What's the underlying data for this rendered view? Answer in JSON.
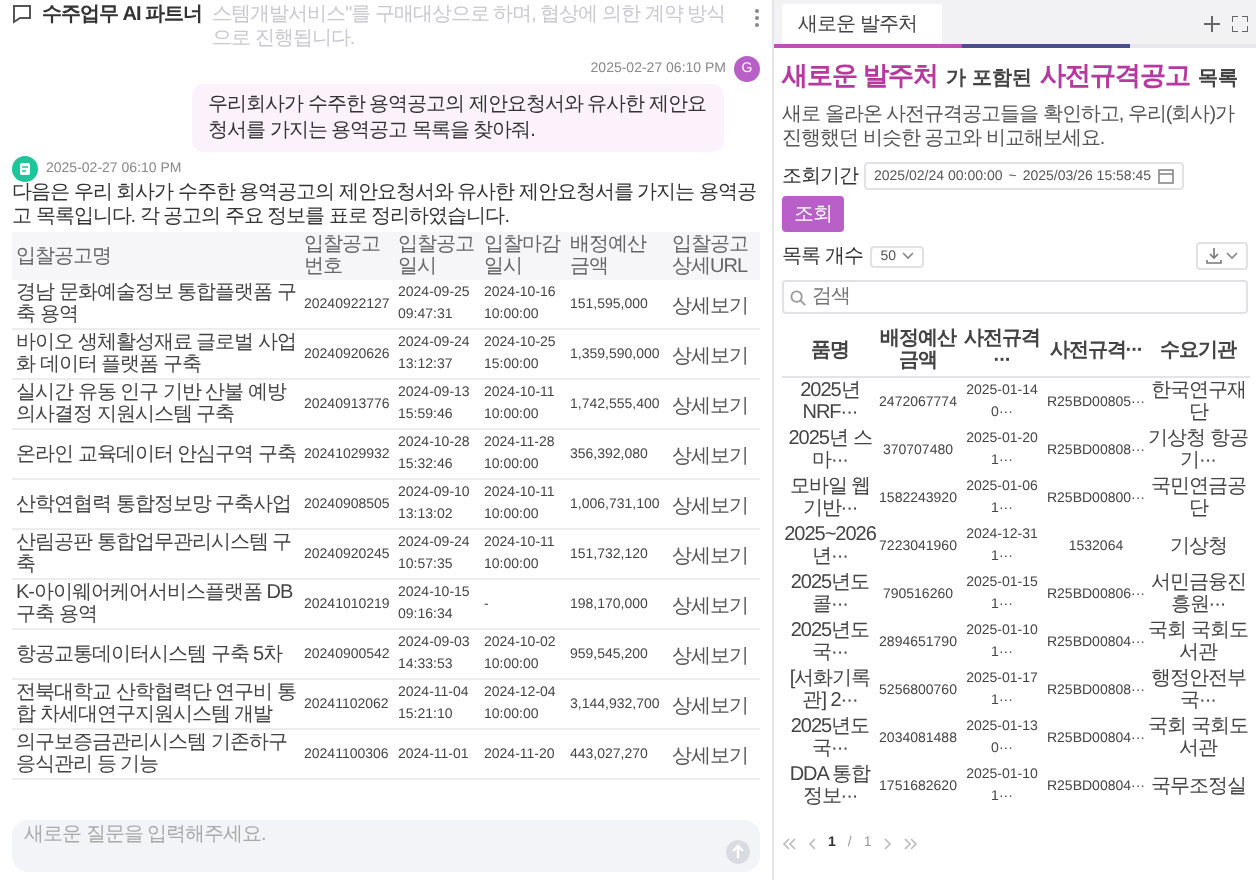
{
  "header": {
    "title": "수주업무 AI 파트너",
    "faded_text": "스템개발서비스\"를 구매대상으로 하며, 협상에 의한 계약 방식으로 진행됩니다."
  },
  "messages": [
    {
      "kind": "user",
      "time": "2025-02-27 06:10 PM",
      "avatar": "G",
      "text": "우리회사가 수주한 용역공고의 제안요청서와 유사한 제안요청서를 가지는 용역공고 목록을 찾아줘."
    },
    {
      "kind": "bot",
      "time": "2025-02-27 06:10 PM",
      "text": "다음은 우리 회사가 수주한 용역공고의 제안요청서와 유사한 제안요청서를 가지는 용역공고 목록입니다. 각 공고의 주요 정보를 표로 정리하였습니다.",
      "table": {
        "columns": [
          {
            "label": "입찰공고명",
            "kind": "text"
          },
          {
            "label": "입찰공고번호",
            "kind": "number"
          },
          {
            "label": "입찰공고일시",
            "kind": "datetime"
          },
          {
            "label": "입찰마감일시",
            "kind": "datetime"
          },
          {
            "label": "배정예산금액",
            "kind": "number"
          },
          {
            "label": "입찰공고상세URL",
            "kind": "link"
          }
        ],
        "rows": [
          [
            "경남 문화예술정보 통합플랫폼 구축 용역",
            "20240922127",
            [
              "2024-09-25",
              "09:47:31"
            ],
            [
              "2024-10-16",
              "10:00:00"
            ],
            "151,595,000",
            "상세보기"
          ],
          [
            "바이오 생체활성재료 글로벌 사업화 데이터 플랫폼 구축",
            "20240920626",
            [
              "2024-09-24",
              "13:12:37"
            ],
            [
              "2024-10-25",
              "15:00:00"
            ],
            "1,359,590,000",
            "상세보기"
          ],
          [
            "실시간 유동 인구 기반 산불 예방 의사결정 지원시스템 구축",
            "20240913776",
            [
              "2024-09-13",
              "15:59:46"
            ],
            [
              "2024-10-11",
              "10:00:00"
            ],
            "1,742,555,400",
            "상세보기"
          ],
          [
            "온라인 교육데이터 안심구역 구축",
            "20241029932",
            [
              "2024-10-28",
              "15:32:46"
            ],
            [
              "2024-11-28",
              "10:00:00"
            ],
            "356,392,080",
            "상세보기"
          ],
          [
            "산학연협력 통합정보망 구축사업",
            "20240908505",
            [
              "2024-09-10",
              "13:13:02"
            ],
            [
              "2024-10-11",
              "10:00:00"
            ],
            "1,006,731,100",
            "상세보기"
          ],
          [
            "산림공판 통합업무관리시스템 구축",
            "20240920245",
            [
              "2024-09-24",
              "10:57:35"
            ],
            [
              "2024-10-11",
              "10:00:00"
            ],
            "151,732,120",
            "상세보기"
          ],
          [
            "K-아이웨어케어서비스플랫폼 DB 구축 용역",
            "20241010219",
            [
              "2024-10-15",
              "09:16:34"
            ],
            [
              "-"
            ],
            "198,170,000",
            "상세보기"
          ],
          [
            "항공교통데이터시스템 구축 5차",
            "20240900542",
            [
              "2024-09-03",
              "14:33:53"
            ],
            [
              "2024-10-02",
              "10:00:00"
            ],
            "959,545,200",
            "상세보기"
          ],
          [
            "전북대학교 산학협력단 연구비 통합 차세대연구지원시스템 개발",
            "20241102062",
            [
              "2024-11-04",
              "15:21:10"
            ],
            [
              "2024-12-04",
              "10:00:00"
            ],
            "3,144,932,700",
            "상세보기"
          ],
          [
            "의구보증금관리시스템 기존하구 응식관리 등 기능",
            "20241100306",
            [
              "2024-11-01"
            ],
            [
              "2024-11-20"
            ],
            "443,027,270",
            "상세보기"
          ]
        ]
      }
    }
  ],
  "chat_input": {
    "placeholder": "새로운 질문을 입력해주세요."
  },
  "panel": {
    "tabs": [
      {
        "label": "새로운 발주처",
        "selected": true
      }
    ],
    "title": [
      {
        "text": "새로운 발주처",
        "kind": "highlight"
      },
      {
        "text": "가 포함된",
        "kind": "plain"
      },
      {
        "text": "사전규격공고",
        "kind": "highlight"
      },
      {
        "text": "목록",
        "kind": "plain"
      }
    ],
    "description": "새로 올라온 사전규격공고들을 확인하고, 우리(회사)가 진행했던 비슷한 공고와 비교해보세요.",
    "period": {
      "label": "조회기간",
      "from": "2025/02/24 00:00:00",
      "separator": "~",
      "to": "2025/03/26 15:58:45",
      "button": "조회"
    },
    "count": {
      "label": "목록 개수",
      "value": "50"
    },
    "search": {
      "placeholder": "검색"
    },
    "table": {
      "columns": [
        {
          "label": "품명",
          "kind": "text"
        },
        {
          "label": "배정예산금액",
          "kind": "number"
        },
        {
          "label": "사전규격···",
          "kind": "number"
        },
        {
          "label": "사전규격···",
          "kind": "number"
        },
        {
          "label": "수요기관",
          "kind": "text"
        }
      ],
      "rows": [
        [
          "2025년 NRF···",
          "2472067774",
          "2025-01-14 0···",
          "R25BD00805···",
          "한국연구재단"
        ],
        [
          "2025년 스마···",
          "370707480",
          "2025-01-20 1···",
          "R25BD00808···",
          "기상청 항공기···"
        ],
        [
          "모바일 웹 기반···",
          "1582243920",
          "2025-01-06 1···",
          "R25BD00800···",
          "국민연금공단"
        ],
        [
          "2025~2026년···",
          "7223041960",
          "2024-12-31 1···",
          "1532064",
          "기상청"
        ],
        [
          "2025년도 콜···",
          "790516260",
          "2025-01-15 1···",
          "R25BD00806···",
          "서민금융진흥원···"
        ],
        [
          "2025년도 국···",
          "2894651790",
          "2025-01-10 1···",
          "R25BD00804···",
          "국회 국회도서관"
        ],
        [
          "[서화기록관] 2···",
          "5256800760",
          "2025-01-17 1···",
          "R25BD00808···",
          "행정안전부 국···"
        ],
        [
          "2025년도 국···",
          "2034081488",
          "2025-01-13 0···",
          "R25BD00804···",
          "국회 국회도서관"
        ],
        [
          "DDA 통합정보···",
          "1751682620",
          "2025-01-10 1···",
          "R25BD00804···",
          "국무조정실"
        ]
      ]
    },
    "pagination": {
      "current": "1",
      "separator": "/",
      "total": "1"
    }
  }
}
